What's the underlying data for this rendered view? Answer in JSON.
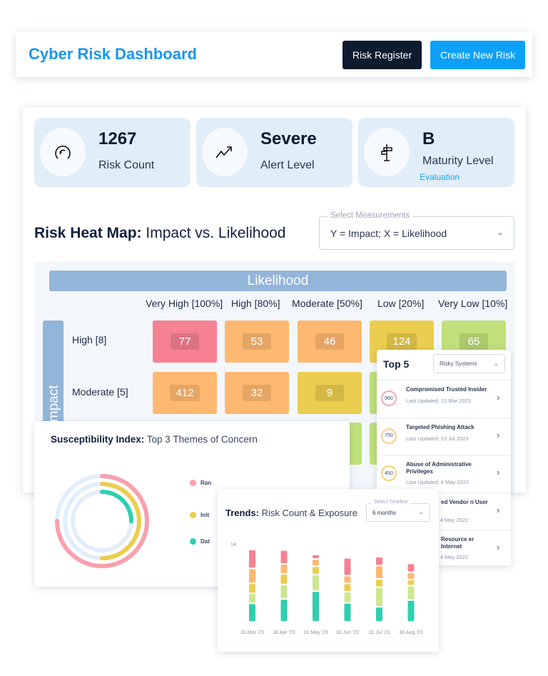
{
  "header": {
    "title": "Cyber Risk Dashboard",
    "risk_register": "Risk Register",
    "create_new_risk": "Create New Risk",
    "colors": {
      "brand": "#1a96f0",
      "dark_button": "#0d1b2e",
      "primary_button": "#0ea0f7"
    }
  },
  "stats": [
    {
      "value": "1267",
      "label": "Risk Count",
      "icon": "gauge-icon"
    },
    {
      "value": "Severe",
      "label": "Alert Level",
      "icon": "trend-up-icon"
    },
    {
      "value": "B",
      "label": "Maturity Level",
      "sub": "Evaluation",
      "icon": "signpost-icon"
    }
  ],
  "heatmap": {
    "title_bold": "Risk Heat Map:",
    "title_rest": " Impact vs. Likelihood",
    "select_label": "Select Measurements",
    "select_value": "Y = Impact; X = Likelihood",
    "likelihood_label": "Likelihood",
    "impact_label": "Impact",
    "columns": [
      "Very High [100%]",
      "High [80%]",
      "Moderate [50%]",
      "Low [20%]",
      "Very Low [10%]"
    ],
    "rows": [
      {
        "label": "High [8]",
        "values": [
          "77",
          "53",
          "46",
          "124",
          "65"
        ],
        "colors": [
          "#f58193",
          "#ffb870",
          "#ffb870",
          "#ebcd4f",
          "#bfe07a"
        ]
      },
      {
        "label": "Moderate [5]",
        "values": [
          "412",
          "32",
          "9",
          "",
          ""
        ],
        "colors": [
          "#ffb870",
          "#ffb870",
          "#ebcd4f",
          "#bfe07a",
          "#bfe07a"
        ]
      },
      {
        "label": "",
        "values": [
          "",
          "",
          "",
          "",
          ""
        ],
        "colors": [
          "#ebcd4f",
          "#ebcd4f",
          "#bfe07a",
          "#bfe07a",
          "#bfe07a"
        ]
      }
    ]
  },
  "top5": {
    "title": "Top 5",
    "select_value": "Risky Systems",
    "updated_label": "Last Updated:",
    "items": [
      {
        "score": "990",
        "name": "Compromised Trusted Insider",
        "date": "13 Mar 2023",
        "color": "#f8a5b3"
      },
      {
        "score": "750",
        "name": "Targeted Phishing Attack",
        "date": "23 Jul 2023",
        "color": "#ffc98a"
      },
      {
        "score": "450",
        "name": "Abuse of Administrative Privileges",
        "date": "4 May 2022",
        "color": "#f3d66a"
      },
      {
        "score": "",
        "name": "ed Vendor n User",
        "date": "4 May 2022",
        "color": "#bfe07a"
      },
      {
        "score": "",
        "name": "Resource er Internet",
        "date": "4 May 2022",
        "color": "#bfe07a"
      }
    ]
  },
  "susceptibility": {
    "title_bold": "Susceptibility Index:",
    "title_rest": " Top 3 Themes of Concern",
    "themes": [
      {
        "label": "Ran",
        "color": "#f8a0ae",
        "fraction": 0.75
      },
      {
        "label": "Init",
        "color": "#ebcd4f",
        "fraction": 0.5
      },
      {
        "label": "Dat",
        "color": "#2ecfb0",
        "fraction": 0.25
      }
    ]
  },
  "trends": {
    "title_bold": "Trends:",
    "title_rest": " Risk Count & Exposure",
    "select_label": "Select Timeline",
    "select_value": "6 months"
  },
  "chart_data": {
    "type": "bar",
    "stacked": true,
    "ytick": "14",
    "ylim": [
      0,
      14
    ],
    "categories": [
      "31 Mar '23",
      "30 Apr '23",
      "31 May '23",
      "30 Jun '23",
      "31 Jul '23",
      "30 Aug '23"
    ],
    "series": [
      {
        "color": "#2ecfb0",
        "values": [
          3.3,
          4.1,
          5.5,
          3.4,
          2.7,
          3.9
        ]
      },
      {
        "color": "#cde78f",
        "values": [
          1.8,
          2.6,
          3.0,
          2.0,
          3.5,
          2.6
        ]
      },
      {
        "color": "#ebcd4f",
        "values": [
          1.8,
          1.9,
          1.5,
          1.5,
          1.5,
          1.1
        ]
      },
      {
        "color": "#ffb870",
        "values": [
          2.7,
          1.8,
          1.3,
          1.4,
          2.4,
          1.3
        ]
      },
      {
        "color": "#f58193",
        "values": [
          3.4,
          2.5,
          0.8,
          3.2,
          1.6,
          1.6
        ]
      }
    ]
  }
}
